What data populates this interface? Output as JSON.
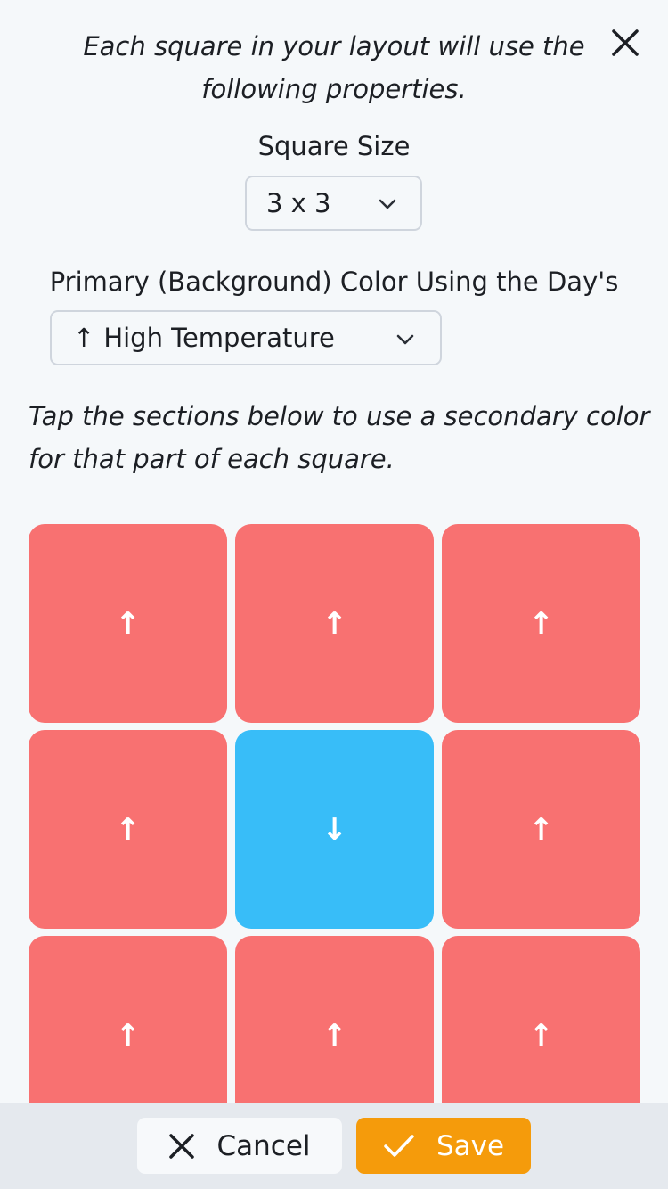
{
  "intro_text": "Each square in your layout will use the following properties.",
  "square_size": {
    "label": "Square Size",
    "value": "3 x 3"
  },
  "primary_color": {
    "label": "Primary (Background) Color Using the Day's",
    "arrow": "↑",
    "value": "High Temperature"
  },
  "instructions": "Tap the sections below to use a secondary color for that part of each square.",
  "colors": {
    "primary": "#f87171",
    "secondary": "#38bdf8",
    "save": "#f59b0b"
  },
  "grid": [
    {
      "arrow": "↑",
      "type": "primary"
    },
    {
      "arrow": "↑",
      "type": "primary"
    },
    {
      "arrow": "↑",
      "type": "primary"
    },
    {
      "arrow": "↑",
      "type": "primary"
    },
    {
      "arrow": "↓",
      "type": "secondary"
    },
    {
      "arrow": "↑",
      "type": "primary"
    },
    {
      "arrow": "↑",
      "type": "primary"
    },
    {
      "arrow": "↑",
      "type": "primary"
    },
    {
      "arrow": "↑",
      "type": "primary"
    }
  ],
  "footer": {
    "cancel_label": "Cancel",
    "save_label": "Save"
  },
  "icons": {
    "close": "close-icon",
    "chevron": "chevron-down-icon",
    "cancel": "x-icon",
    "save": "check-icon"
  }
}
